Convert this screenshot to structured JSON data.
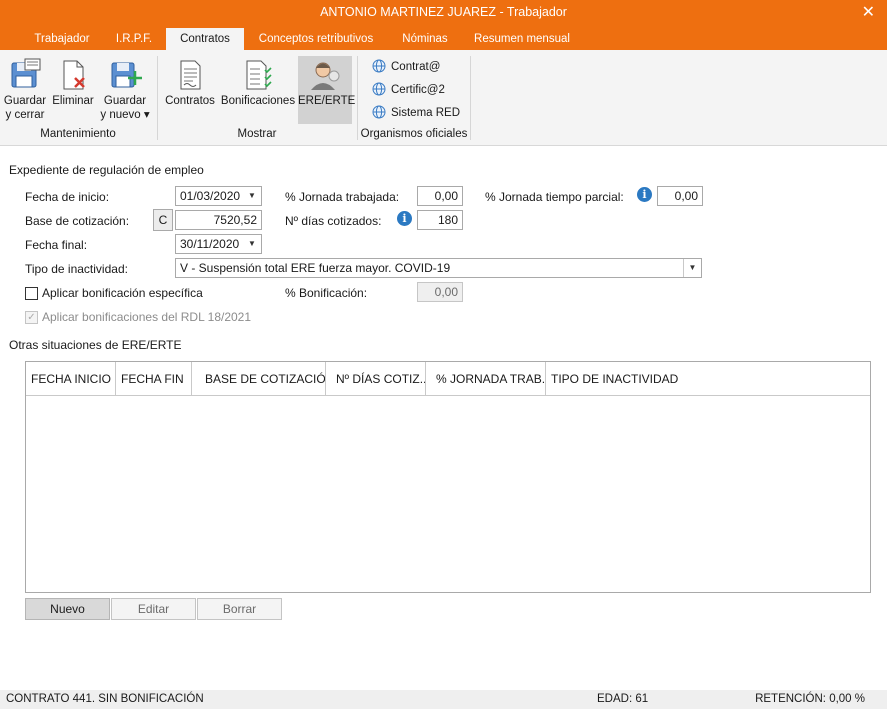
{
  "window": {
    "title": "ANTONIO MARTINEZ JUAREZ - Trabajador",
    "close_glyph": "✕",
    "accent_color": "#ee6f10"
  },
  "tabs": [
    {
      "label": "Trabajador",
      "active": false
    },
    {
      "label": "I.R.P.F.",
      "active": false
    },
    {
      "label": "Contratos",
      "active": true
    },
    {
      "label": "Conceptos retributivos",
      "active": false
    },
    {
      "label": "Nóminas",
      "active": false
    },
    {
      "label": "Resumen mensual",
      "active": false
    }
  ],
  "ribbon": {
    "mantenimiento": {
      "label": "Mantenimiento",
      "guardar_cerrar": {
        "line1": "Guardar",
        "line2": "y cerrar",
        "icon": "save-close-icon"
      },
      "eliminar": {
        "label": "Eliminar",
        "icon": "delete-document-icon"
      },
      "guardar_nuevo": {
        "line1": "Guardar",
        "line2": "y nuevo ▾",
        "icon": "save-new-icon"
      }
    },
    "mostrar": {
      "label": "Mostrar",
      "contratos": {
        "label": "Contratos",
        "icon": "contract-document-icon"
      },
      "bonificaciones": {
        "label": "Bonificaciones",
        "icon": "checklist-document-icon"
      },
      "ere_erte": {
        "label": "ERE/ERTE",
        "icon": "worker-person-icon",
        "selected": true
      }
    },
    "organismos": {
      "label": "Organismos oficiales",
      "links": [
        {
          "label": "Contrat@",
          "icon": "globe-icon"
        },
        {
          "label": "Certific@2",
          "icon": "globe-icon"
        },
        {
          "label": "Sistema RED",
          "icon": "globe-icon"
        }
      ]
    }
  },
  "form": {
    "section_title": "Expediente de regulación de empleo",
    "fecha_inicio": {
      "label": "Fecha de inicio:",
      "value": "01/03/2020"
    },
    "base_cotizacion": {
      "label": "Base de cotización:",
      "button": "C",
      "value": "7520,52"
    },
    "fecha_final": {
      "label": "Fecha final:",
      "value": "30/11/2020"
    },
    "tipo_inactividad": {
      "label": "Tipo de inactividad:",
      "value": "V - Suspensión total ERE fuerza mayor. COVID-19"
    },
    "jornada_trabajada": {
      "label": "% Jornada trabajada:",
      "value": "0,00"
    },
    "dias_cotizados": {
      "label": "Nº días cotizados:",
      "value": "180"
    },
    "jornada_parcial": {
      "label": "% Jornada tiempo parcial:",
      "value": "0,00"
    },
    "bonificacion_especifica": {
      "label": "Aplicar bonificación específica",
      "checked": false
    },
    "porcentaje_bonificacion": {
      "label": "% Bonificación:",
      "value": "0,00"
    },
    "bonificaciones_rdl": {
      "label": "Aplicar bonificaciones del RDL 18/2021",
      "checked": true,
      "enabled": false
    },
    "dropdown_glyph": "▼",
    "info_glyph": "i"
  },
  "otras": {
    "section_title": "Otras situaciones de ERE/ERTE",
    "columns": [
      "FECHA INICIO",
      "FECHA FIN",
      "BASE DE COTIZACIÓN",
      "Nº DÍAS COTIZ...",
      "% JORNADA TRAB...",
      "TIPO DE INACTIVIDAD"
    ],
    "rows": [],
    "buttons": {
      "nuevo": "Nuevo",
      "editar": "Editar",
      "borrar": "Borrar"
    }
  },
  "status": {
    "contrato": "CONTRATO 441.  SIN BONIFICACIÓN",
    "edad": "EDAD: 61",
    "retencion": "RETENCIÓN: 0,00 %"
  }
}
